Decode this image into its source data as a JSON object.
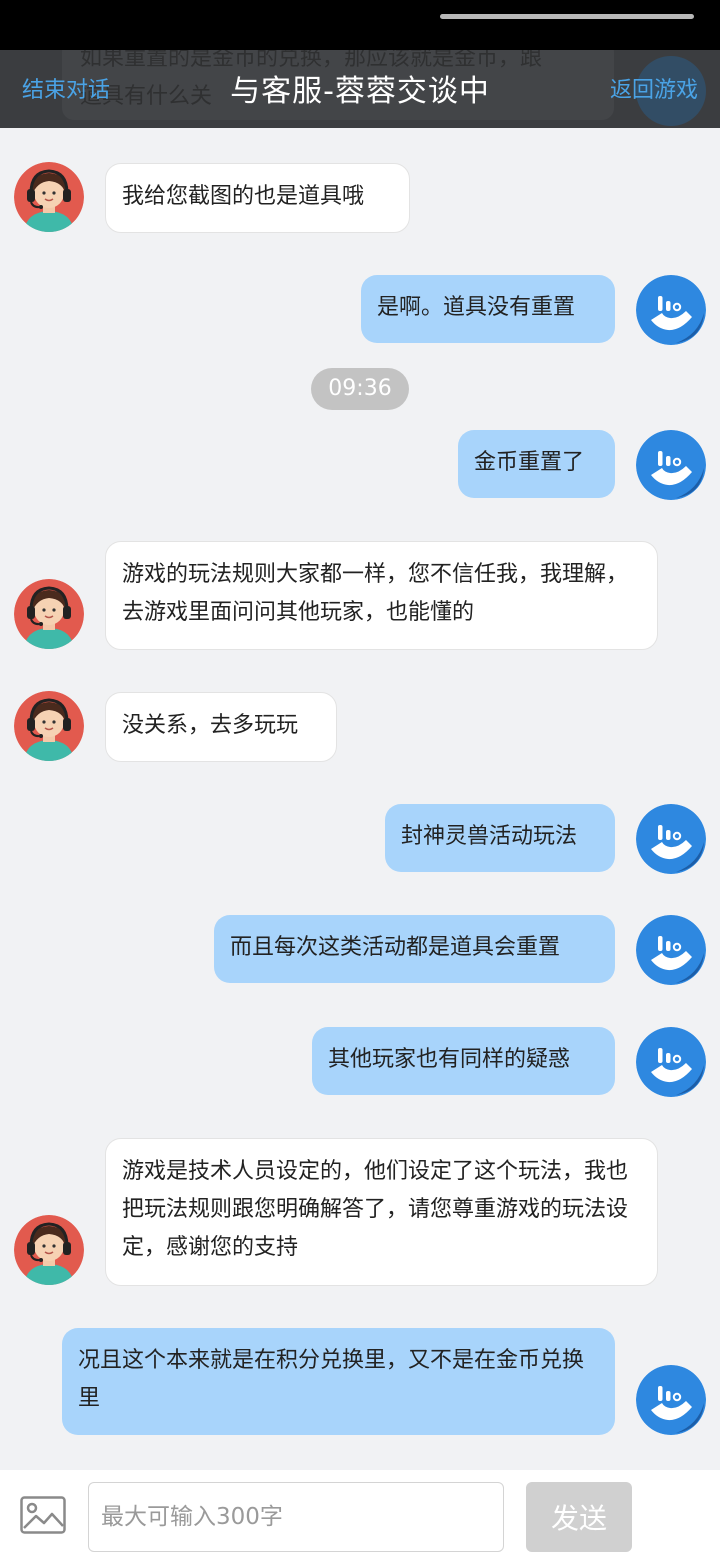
{
  "header": {
    "left_action": "结束对话",
    "title": "与客服-蓉蓉交谈中",
    "right_action": "返回游戏",
    "obscured_preview_line1": "如果重置的是金币的兑换，那应该就是金币，跟",
    "obscured_preview_line2": "道具有什么关"
  },
  "messages": [
    {
      "side": "left",
      "text": "我给您截图的也是道具哦"
    },
    {
      "side": "right",
      "text": "是啊。道具没有重置"
    },
    {
      "side": "time",
      "text": "09:36"
    },
    {
      "side": "right",
      "text": "金币重置了"
    },
    {
      "side": "left",
      "text": "游戏的玩法规则大家都一样，您不信任我，我理解，去游戏里面问问其他玩家，也能懂的"
    },
    {
      "side": "left",
      "text": "没关系，去多玩玩"
    },
    {
      "side": "right",
      "text": "封神灵兽活动玩法"
    },
    {
      "side": "right",
      "text": "而且每次这类活动都是道具会重置"
    },
    {
      "side": "right",
      "text": "其他玩家也有同样的疑惑"
    },
    {
      "side": "left",
      "text": "游戏是技术人员设定的，他们设定了这个玩法，我也把玩法规则跟您明确解答了，请您尊重游戏的玩法设定，感谢您的支持"
    },
    {
      "side": "right",
      "text": "况且这个本来就是在积分兑换里，又不是在金币兑换里"
    }
  ],
  "input": {
    "placeholder": "最大可输入300字",
    "value": ""
  },
  "send_label": "发送",
  "icons": {
    "agent_avatar": "agent-headset-avatar-icon",
    "user_avatar": "phone-logo-avatar-icon",
    "image": "image-picker-icon"
  },
  "colors": {
    "header_bg": "#3b3d40",
    "header_link": "#4aa3e6",
    "user_bubble": "#a8d4fb",
    "agent_bubble": "#ffffff",
    "page_bg": "#f1f2f4",
    "send_disabled": "#d0d0d0"
  }
}
